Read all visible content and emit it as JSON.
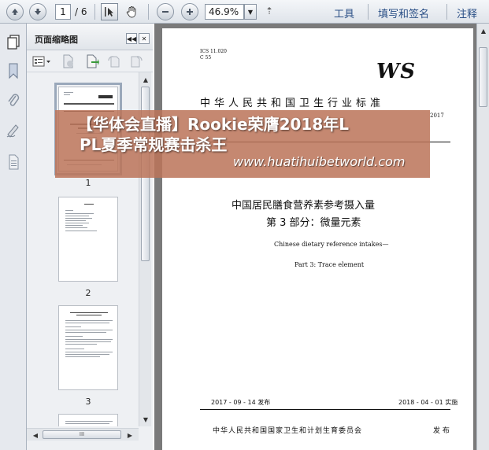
{
  "toolbar": {
    "page_current": "1",
    "page_total": "/ 6",
    "zoom": "46.9%",
    "menu_glyph": "⇡",
    "tools_label": "工具",
    "fill_sign_label": "填写和签名",
    "comment_label": "注释",
    "icons": [
      "arrow-up-icon",
      "arrow-down-icon",
      "select-cursor-icon",
      "hand-icon",
      "zoom-out-icon",
      "zoom-in-icon"
    ]
  },
  "thumbnails_panel": {
    "title": "页面缩略图",
    "pages": [
      {
        "label": "1"
      },
      {
        "label": "2"
      },
      {
        "label": "3"
      }
    ],
    "scroll_label": "III"
  },
  "document": {
    "ics_line1": "ICS 11.020",
    "ics_line2": "C 55",
    "logo": "WS",
    "standard_title": "中华人民共和国卫生行业标准",
    "year_fragment": "2017",
    "cn_title_line1": "中国居民膳食营养素参考摄入量",
    "cn_title_line2": "第 3 部分：微量元素",
    "en_title_line1": "Chinese dietary reference intakes—",
    "en_title_line2": "Part 3: Trace element",
    "publish_date": "2017 - 09 - 14 发布",
    "effective_date": "2018 - 04 - 01 实施",
    "issuer": "中华人民共和国国家卫生和计划生育委员会",
    "issue_word": "发 布"
  },
  "overlay": {
    "line1": "【华体会直播】Rookie荣膺2018年L",
    "line2": "PL夏季常规赛击杀王",
    "url": "www.huatihuibetworld.com"
  }
}
